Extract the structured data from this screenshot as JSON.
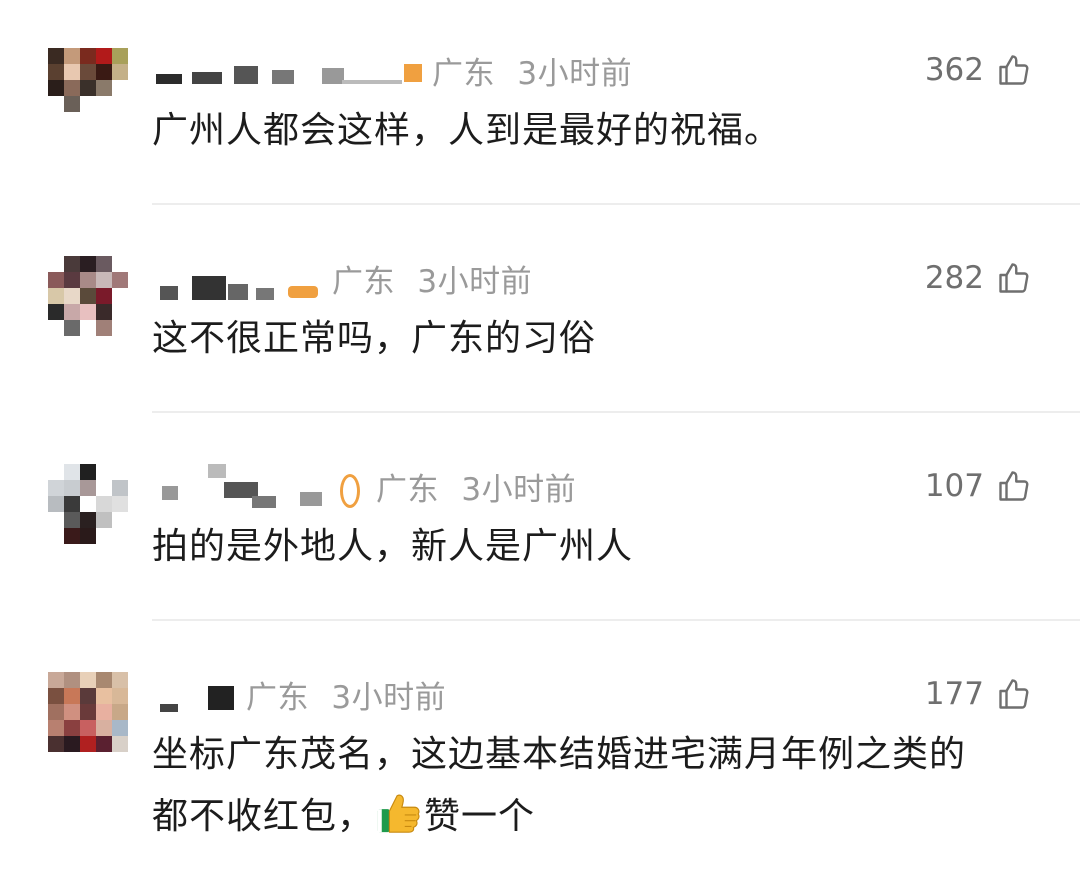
{
  "comments": [
    {
      "location": "广东",
      "time": "3小时前",
      "likes": "362",
      "text": "广州人都会这样，人到是最好的祝福。",
      "avatar_colors": [
        "#3a2a22",
        "#c49a7a",
        "#7a2a1e",
        "#b21a1a",
        "#a8a05a",
        "#5a4030",
        "#e8c8b0",
        "#6a4a3a",
        "#3a1a14",
        "#c4b088",
        "#2a1e1a",
        "#8a6a5a",
        "#3a302a",
        "#8a7a6a",
        "#ffffff",
        "#ffffff",
        "#6a6058",
        "#ffffff",
        "#ffffff",
        "#ffffff",
        "#ffffff",
        "#ffffff",
        "#ffffff",
        "#ffffff",
        "#ffffff"
      ]
    },
    {
      "location": "广东",
      "time": "3小时前",
      "likes": "282",
      "text": "这不很正常吗，广东的习俗",
      "avatar_colors": [
        "#ffffff",
        "#4a3a3a",
        "#2a1e22",
        "#6a5a60",
        "#ffffff",
        "#8a5a5a",
        "#5a3a40",
        "#a88a88",
        "#c8b8b8",
        "#a07878",
        "#d8c8a8",
        "#e8d8c8",
        "#5a4a3a",
        "#7a1a2a",
        "#ffffff",
        "#2a2a2a",
        "#c8a8a8",
        "#e8c0c0",
        "#3a2a2a",
        "#ffffff",
        "#ffffff",
        "#6a6a6a",
        "#ffffff",
        "#a08078",
        "#ffffff"
      ]
    },
    {
      "location": "广东",
      "time": "3小时前",
      "likes": "107",
      "text": "拍的是外地人，新人是广州人",
      "avatar_colors": [
        "#ffffff",
        "#e0e4e8",
        "#202020",
        "#ffffff",
        "#ffffff",
        "#d0d4d8",
        "#c8ccd0",
        "#a89898",
        "#ffffff",
        "#c0c4c8",
        "#b8bcc0",
        "#3a3a3a",
        "#ffffff",
        "#d8d8d8",
        "#e0e0e0",
        "#ffffff",
        "#5a5a5a",
        "#2a2020",
        "#c0c0c0",
        "#ffffff",
        "#ffffff",
        "#3a1a1a",
        "#2a1a1a",
        "#ffffff",
        "#ffffff"
      ]
    },
    {
      "location": "广东",
      "time": "3小时前",
      "likes": "177",
      "text_line1": "坐标广东茂名，这边基本结婚进宅满月年例之类的",
      "text_line2a": "都不收红包，",
      "text_line2b": "赞一个",
      "avatar_colors": [
        "#c8a898",
        "#b09080",
        "#e8d0b8",
        "#a88870",
        "#d8c0a8",
        "#7a5040",
        "#c87858",
        "#5a3a3a",
        "#e8c0a0",
        "#d8b898",
        "#a07060",
        "#d09080",
        "#6a3a3a",
        "#e8b0a0",
        "#c8a888",
        "#b88070",
        "#8a4040",
        "#c86060",
        "#d8b0a0",
        "#a8b8c8",
        "#4a3030",
        "#2a1a20",
        "#b02020",
        "#5a2030",
        "#d8d0c8"
      ]
    }
  ],
  "colors": {
    "meta": "#9a9a9a",
    "text": "#1c1c1c",
    "divider": "#ededed",
    "name_accent": "#f0a040"
  },
  "icons": {
    "like": "thumbs-up-outline-icon",
    "emoji": "thumbs-up-emoji-icon"
  }
}
